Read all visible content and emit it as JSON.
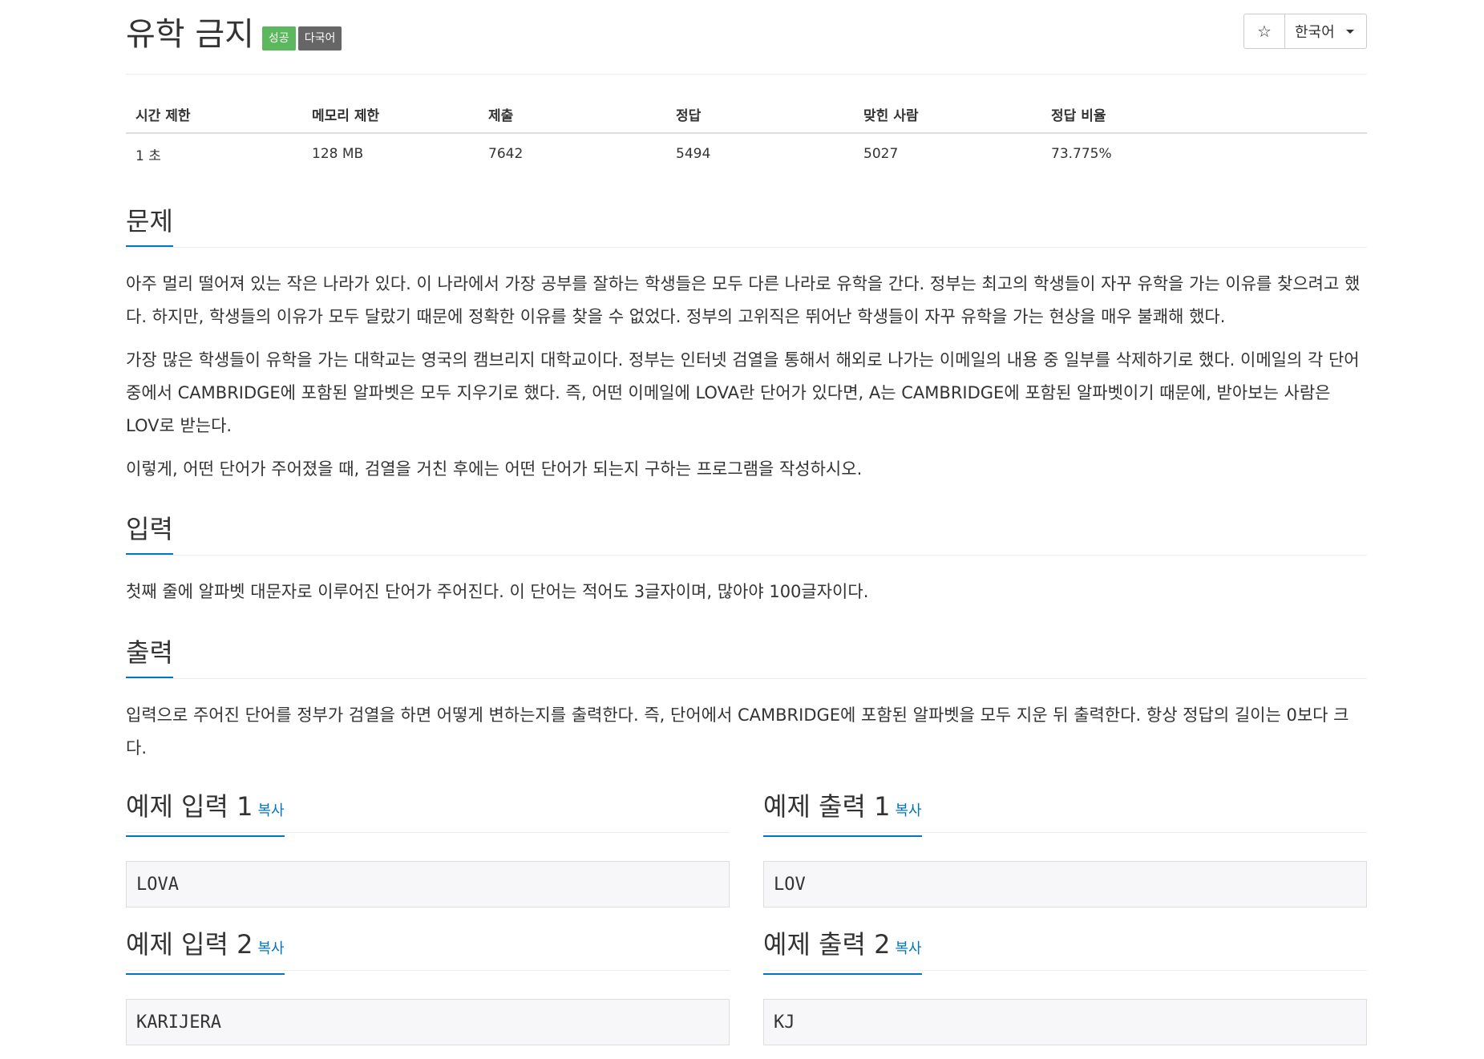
{
  "problem": {
    "title": "유학 금지",
    "labels": {
      "success": "성공",
      "multilang": "다국어"
    },
    "header_buttons": {
      "star_icon": "☆",
      "language": "한국어"
    },
    "info_table": {
      "headers": [
        "시간 제한",
        "메모리 제한",
        "제출",
        "정답",
        "맞힌 사람",
        "정답 비율"
      ],
      "values": [
        "1 초",
        "128 MB",
        "7642",
        "5494",
        "5027",
        "73.775%"
      ]
    },
    "description": {
      "heading": "문제",
      "paragraphs": [
        "아주 멀리 떨어져 있는 작은 나라가 있다. 이 나라에서 가장 공부를 잘하는 학생들은 모두 다른 나라로 유학을 간다. 정부는 최고의 학생들이 자꾸 유학을 가는 이유를 찾으려고 했다. 하지만, 학생들의 이유가 모두 달랐기 때문에 정확한 이유를 찾을 수 없었다. 정부의 고위직은 뛰어난 학생들이 자꾸 유학을 가는 현상을 매우 불쾌해 했다.",
        "가장 많은 학생들이 유학을 가는 대학교는 영국의 캠브리지 대학교이다. 정부는 인터넷 검열을 통해서 해외로 나가는 이메일의 내용 중 일부를 삭제하기로 했다. 이메일의 각 단어 중에서 CAMBRIDGE에 포함된 알파벳은 모두 지우기로 했다. 즉, 어떤 이메일에 LOVA란 단어가 있다면, A는 CAMBRIDGE에 포함된 알파벳이기 때문에, 받아보는 사람은 LOV로 받는다.",
        "이렇게, 어떤 단어가 주어졌을 때, 검열을 거친 후에는 어떤 단어가 되는지 구하는 프로그램을 작성하시오."
      ]
    },
    "input": {
      "heading": "입력",
      "text": "첫째 줄에 알파벳 대문자로 이루어진 단어가 주어진다. 이 단어는 적어도 3글자이며, 많아야 100글자이다."
    },
    "output": {
      "heading": "출력",
      "text": "입력으로 주어진 단어를 정부가 검열을 하면 어떻게 변하는지를 출력한다. 즉, 단어에서 CAMBRIDGE에 포함된 알파벳을 모두 지운 뒤 출력한다. 항상 정답의 길이는 0보다 크다."
    },
    "samples": {
      "copy_label": "복사",
      "input1_heading": "예제 입력 1",
      "output1_heading": "예제 출력 1",
      "input2_heading": "예제 입력 2",
      "output2_heading": "예제 출력 2",
      "input1": "LOVA",
      "output1": "LOV",
      "input2": "KARIJERA",
      "output2": "KJ"
    }
  }
}
